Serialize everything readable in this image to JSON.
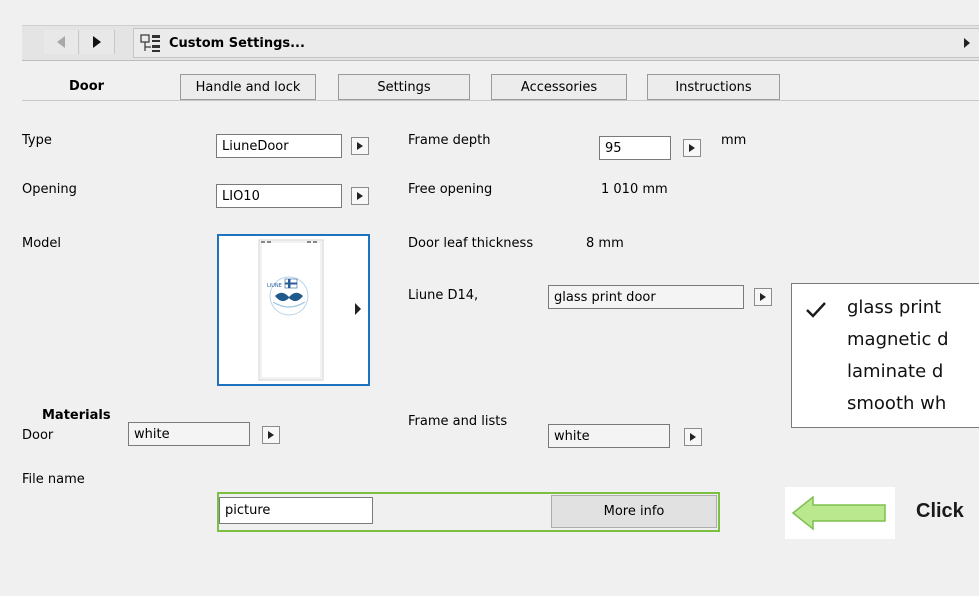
{
  "toolbar": {
    "title": "Custom Settings..."
  },
  "tabs": {
    "door": "Door",
    "handle": "Handle and lock",
    "settings": "Settings",
    "accessories": "Accessories",
    "instructions": "Instructions"
  },
  "type": {
    "label": "Type",
    "value": "LiuneDoor"
  },
  "frame_depth": {
    "label": "Frame depth",
    "value": "95",
    "unit": "mm"
  },
  "opening": {
    "label": "Opening",
    "value": "LIO10"
  },
  "free_opening": {
    "label": "Free opening",
    "value": "1 010 mm"
  },
  "model": {
    "label": "Model",
    "logo_text": "LIUNE"
  },
  "leaf": {
    "label": "Door leaf thickness",
    "value": "8 mm"
  },
  "liune": {
    "label": "Liune D14,",
    "value": "glass print door"
  },
  "dropdown": {
    "options": [
      "glass print",
      "magnetic d",
      "laminate d",
      "smooth wh"
    ],
    "selected": "glass print"
  },
  "materials": {
    "heading": "Materials",
    "door_label": "Door",
    "door_value": "white",
    "frame_label": "Frame and lists",
    "frame_value": "white"
  },
  "file": {
    "label": "File name",
    "value": "picture",
    "more_info": "More info"
  },
  "hint": {
    "text": "Click"
  },
  "colors": {
    "accent_blue": "#1e73be",
    "highlight_green": "#7bc043",
    "arrow_green": "#b9e88f"
  }
}
